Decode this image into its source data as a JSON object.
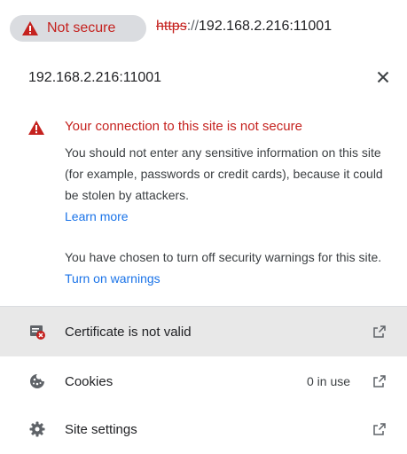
{
  "omnibox": {
    "chip_label": "Not secure",
    "url_scheme": "https",
    "url_separator": "://",
    "url_host": "192.168.2.216:11001"
  },
  "popup": {
    "title": "192.168.2.216:11001",
    "warning": {
      "title": "Your connection to this site is not secure",
      "body": "You should not enter any sensitive information on this site (for example, passwords or credit cards), because it could be stolen by attackers.",
      "learn_more": "Learn more",
      "turned_off": "You have chosen to turn off security warnings for this site.",
      "turn_on": "Turn on warnings"
    },
    "rows": [
      {
        "label": "Certificate is not valid",
        "meta": ""
      },
      {
        "label": "Cookies",
        "meta": "0 in use"
      },
      {
        "label": "Site settings",
        "meta": ""
      }
    ]
  },
  "colors": {
    "danger": "#c5221f",
    "link": "#1a73e8",
    "chip_bg": "#dadce0",
    "row_hover": "#e8e8e8"
  },
  "icons": [
    "warning-triangle-icon",
    "close-icon",
    "certificate-icon",
    "cookie-icon",
    "gear-icon",
    "open-external-icon"
  ]
}
